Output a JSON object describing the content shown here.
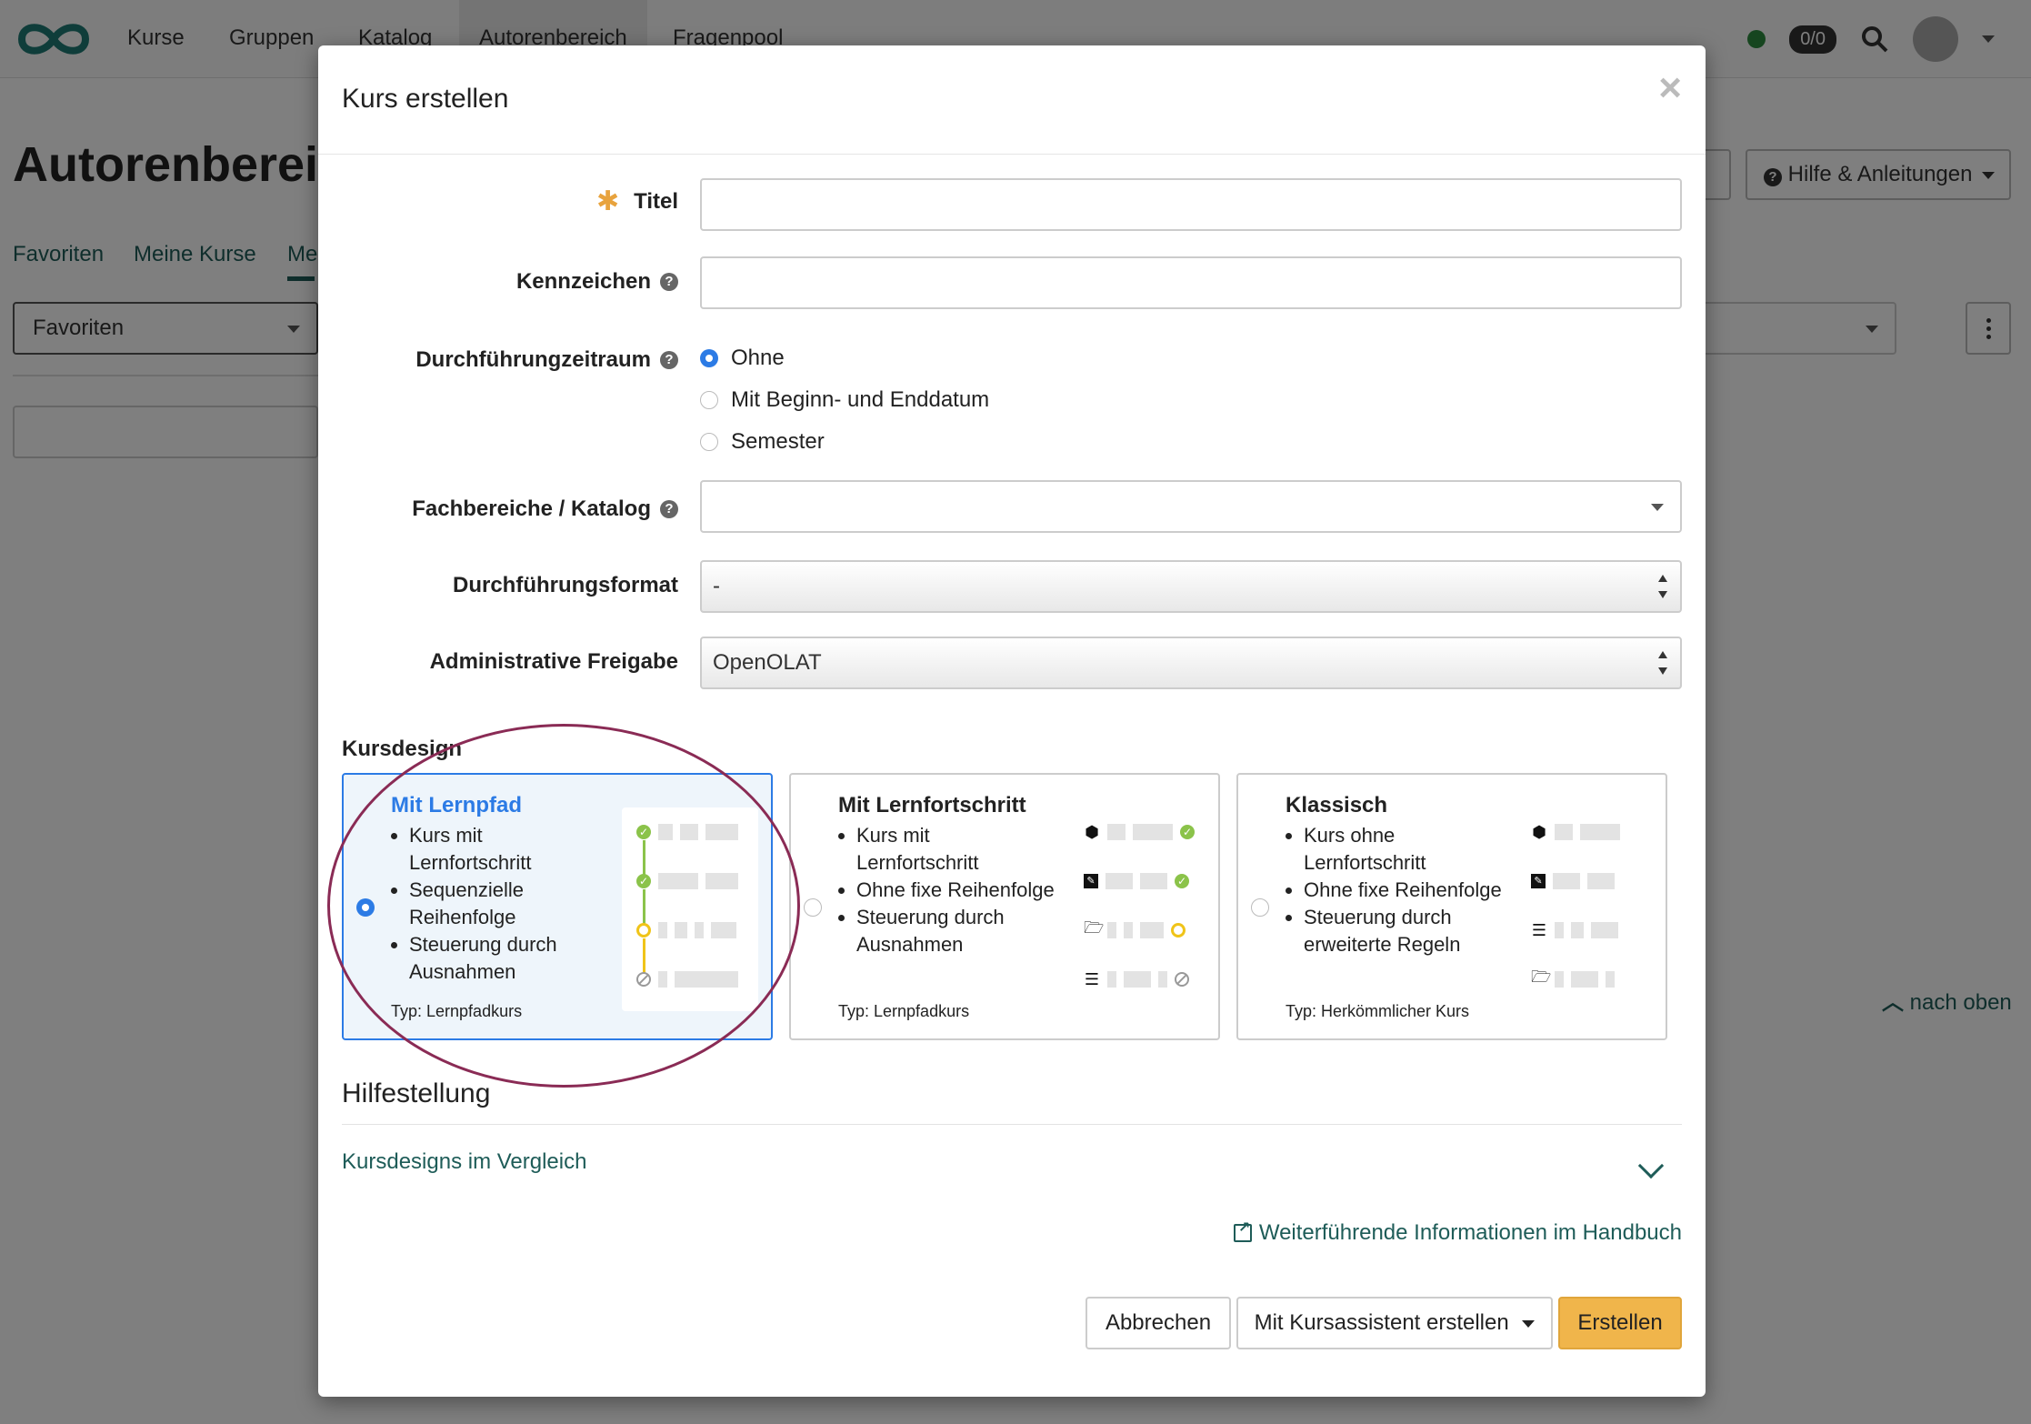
{
  "topnav": {
    "items": [
      "Kurse",
      "Gruppen",
      "Katalog",
      "Autorenbereich",
      "Fragenpool"
    ],
    "badge": "0/0"
  },
  "background": {
    "page_title": "Autorenbereich",
    "help_button": "Hilfe & Anleitungen",
    "tabs": [
      "Favoriten",
      "Meine Kurse",
      "Me"
    ],
    "filter_select": "Favoriten",
    "back_to_top": "nach oben"
  },
  "modal": {
    "title": "Kurs erstellen",
    "close": "×",
    "fields": {
      "titel_label": "Titel",
      "titel_value": "",
      "kennzeichen_label": "Kennzeichen",
      "kennzeichen_value": "",
      "zeitraum_label": "Durchführungzeitraum",
      "zeitraum_options": [
        "Ohne",
        "Mit Beginn- und Enddatum",
        "Semester"
      ],
      "zeitraum_selected": "Ohne",
      "fachbereiche_label": "Fachbereiche / Katalog",
      "fachbereiche_value": "",
      "format_label": "Durchführungsformat",
      "format_value": "-",
      "freigabe_label": "Administrative Freigabe",
      "freigabe_value": "OpenOLAT"
    },
    "kursdesign": {
      "label": "Kursdesign",
      "selected": "Mit Lernpfad",
      "cards": [
        {
          "title": "Mit Lernpfad",
          "bullets": [
            "Kurs mit Lernfortschritt",
            "Sequenzielle Reihenfolge",
            "Steuerung durch Ausnahmen"
          ],
          "type": "Typ: Lernpfadkurs"
        },
        {
          "title": "Mit Lernfortschritt",
          "bullets": [
            "Kurs mit Lernfortschritt",
            "Ohne fixe Reihenfolge",
            "Steuerung durch Ausnahmen"
          ],
          "type": "Typ: Lernpfadkurs"
        },
        {
          "title": "Klassisch",
          "bullets": [
            "Kurs ohne Lernfortschritt",
            "Ohne fixe Reihenfolge",
            "Steuerung durch erweiterte Regeln"
          ],
          "type": "Typ: Herkömmlicher Kurs"
        }
      ]
    },
    "hilfe": {
      "title": "Hilfestellung",
      "accordion_link": "Kursdesigns im Vergleich",
      "handbuch_link": "Weiterführende Informationen im Handbuch"
    },
    "buttons": {
      "cancel": "Abbrechen",
      "wizard": "Mit Kursassistent erstellen",
      "create": "Erstellen"
    }
  },
  "colors": {
    "brand_teal": "#1e5c58",
    "accent_blue": "#2c7be5",
    "primary_button": "#f0b54b",
    "highlight_ellipse": "#8a2b55"
  }
}
